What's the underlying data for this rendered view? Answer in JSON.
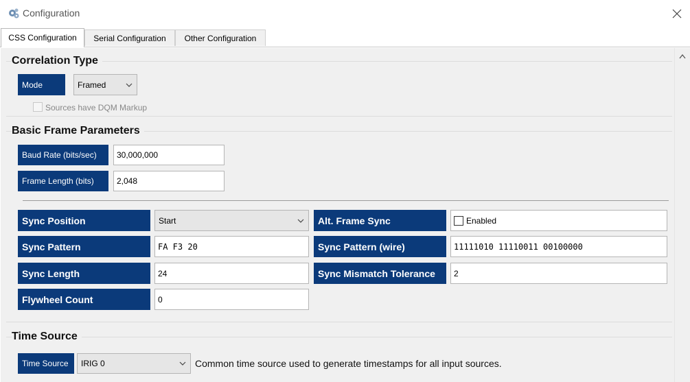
{
  "window": {
    "title": "Configuration",
    "app_icon": "gear-cluster-icon",
    "close_icon": "close-icon"
  },
  "tabs": [
    {
      "label": "CSS Configuration",
      "active": true
    },
    {
      "label": "Serial Configuration",
      "active": false
    },
    {
      "label": "Other Configuration",
      "active": false
    }
  ],
  "correlation": {
    "title": "Correlation Type",
    "mode_label": "Mode",
    "mode_value": "Framed",
    "dqm_label": "Sources have DQM Markup",
    "dqm_checked": false
  },
  "basic_frame": {
    "title": "Basic Frame Parameters",
    "baud_label": "Baud Rate (bits/sec)",
    "baud_value": "30,000,000",
    "frame_length_label": "Frame Length (bits)",
    "frame_length_value": "2,048"
  },
  "sync": {
    "position_label": "Sync Position",
    "position_value": "Start",
    "pattern_label": "Sync Pattern",
    "pattern_value": "FA F3 20",
    "length_label": "Sync Length",
    "length_value": "24",
    "flywheel_label": "Flywheel Count",
    "flywheel_value": "0",
    "alt_frame_label": "Alt. Frame Sync",
    "alt_frame_checkbox_label": "Enabled",
    "alt_frame_enabled": false,
    "pattern_wire_label": "Sync Pattern (wire)",
    "pattern_wire_value": "11111010 11110011 00100000",
    "mismatch_label": "Sync Mismatch Tolerance",
    "mismatch_value": "2"
  },
  "time_source": {
    "title": "Time Source",
    "label": "Time Source",
    "value": "IRIG 0",
    "help": "Common time source used to generate timestamps for all input sources."
  },
  "colors": {
    "label_bg": "#0b3a7a",
    "panel_bg": "#f0f0f0"
  }
}
